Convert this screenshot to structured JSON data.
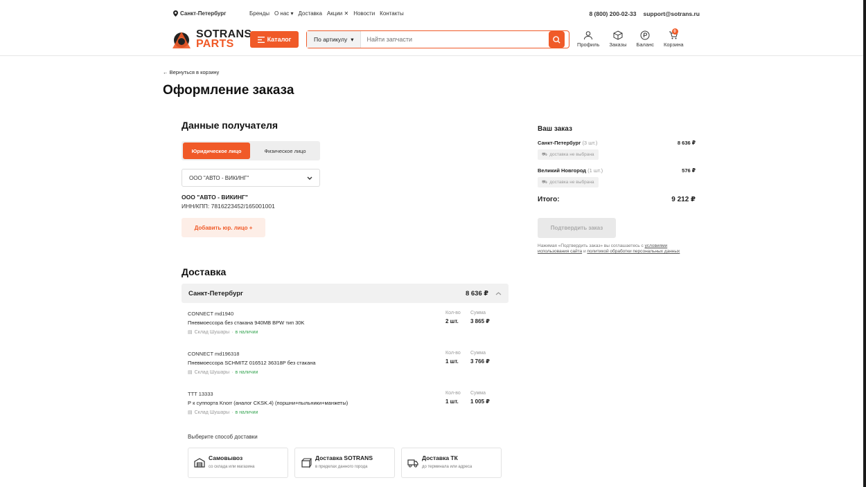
{
  "topbar": {
    "city": "Санкт-Петербург",
    "nav": [
      "Бренды",
      "О нас ▾",
      "Доставка",
      "Акции ✕",
      "Новости",
      "Контакты"
    ],
    "phone": "8 (800) 200-02-33",
    "email": "support@sotrans.ru"
  },
  "header": {
    "logo_line1": "SOTRANS",
    "logo_line2": "PARTS",
    "catalog": "Каталог",
    "search_mode": "По артикулу",
    "search_placeholder": "Найти запчасти",
    "profile": "Профиль",
    "orders": "Заказы",
    "balance": "Баланс",
    "cart": "Корзина",
    "cart_count": "0"
  },
  "page": {
    "back": "← Вернуться в корзину",
    "title": "Оформление заказа"
  },
  "recipient": {
    "title": "Данные получателя",
    "tab_legal": "Юридическое лицо",
    "tab_person": "Физическое лицо",
    "selected_org": "ООО \"АВТО - ВИКИНГ\"",
    "org_name": "ООО \"АВТО - ВИКИНГ\"",
    "org_inn": "ИНН/КПП: 7816223452/165001001",
    "add_org": "Добавить юр. лицо +"
  },
  "delivery": {
    "title": "Доставка",
    "city": "Санкт-Петербург",
    "city_total": "8 636 ₽",
    "qty_label": "Кол-во",
    "sum_label": "Сумма",
    "stock_place": "Склад Шушары",
    "stock_status": "в наличии",
    "items": [
      {
        "brand": "CONNECT  md1940",
        "desc": "Пневмоессора без стакана 940MB BPW тип 30K",
        "qty": "2 шт.",
        "sum": "3 865 ₽"
      },
      {
        "brand": "CONNECT  md196318",
        "desc": "Пневмоессора SCHMITZ 016512 36318P без стакана",
        "qty": "1 шт.",
        "sum": "3 766 ₽"
      },
      {
        "brand": "TTT  13333",
        "desc": "Р к суппорта Knorr (аналог CKSK.4) (поршни+пыльники+манжеты)",
        "qty": "1 шт.",
        "sum": "1 005 ₽"
      }
    ],
    "choose": "Выберите способ доставки",
    "options": [
      {
        "title": "Самовывоз",
        "sub": "со склада или магазина"
      },
      {
        "title": "Доставка SOTRANS",
        "sub": "в пределах данного города"
      },
      {
        "title": "Доставка ТК",
        "sub": "до терминала или адреса"
      }
    ]
  },
  "summary": {
    "title": "Ваш заказ",
    "rows": [
      {
        "city": "Санкт-Петербург",
        "count": "(3 шт.)",
        "price": "8 636 ₽",
        "chip": "доставка не выбрана"
      },
      {
        "city": "Великий Новгород",
        "count": "(1 шт.)",
        "price": "576 ₽",
        "chip": "доставка не выбрана"
      }
    ],
    "total_label": "Итого:",
    "total_value": "9 212 ₽",
    "confirm": "Подтвердить заказ",
    "consent_pre": "Нажимая «Подтвердить заказ» вы соглашаетесь с ",
    "consent_link1": "условиями использования сайта",
    "consent_mid": " и ",
    "consent_link2": "политикой обработки персональных данных"
  },
  "colors": {
    "accent": "#f05a28",
    "ok": "#3aa655"
  }
}
